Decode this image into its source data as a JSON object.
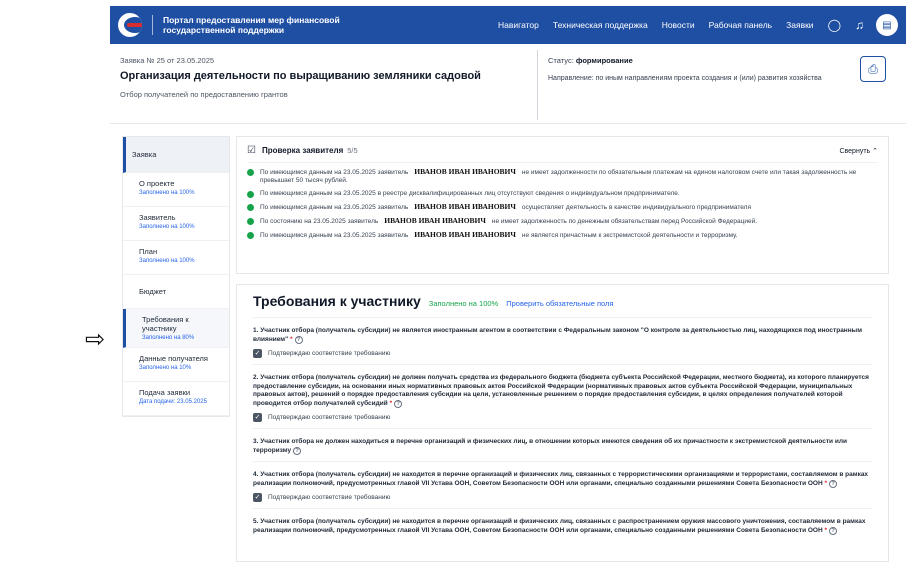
{
  "header": {
    "brand_line1": "Портал предоставления мер финансовой",
    "brand_line2": "государственной поддержки",
    "nav": [
      "Навигатор",
      "Техническая поддержка",
      "Новости",
      "Рабочая панель",
      "Заявки"
    ],
    "icons": [
      "chat-icon",
      "bell-icon",
      "avatar-icon"
    ]
  },
  "application": {
    "number": "Заявка № 25  от 23.05.2025",
    "title": "Организация деятельности по выращиванию земляники садовой",
    "subtitle": "Отбор получателей по предоставлению грантов",
    "status_label": "Статус:",
    "status_value": "формирование",
    "direction": "Направление: по иным направлениям проекта создания и (или) развития хозяйства"
  },
  "sidebar": {
    "head": "Заявка",
    "items": [
      {
        "label": "О проекте",
        "progress": "Заполнено на 100%"
      },
      {
        "label": "Заявитель",
        "progress": "Заполнено на 100%"
      },
      {
        "label": "План",
        "progress": "Заполнено на 100%"
      },
      {
        "label": "Бюджет",
        "progress": ""
      },
      {
        "label": "Требования к участнику",
        "progress": "Заполнено на 80%"
      },
      {
        "label": "Данные получателя",
        "progress": "Заполнено на 10%"
      },
      {
        "label": "Подача заявки",
        "progress": "Дата подачи: 23.05.2025"
      }
    ]
  },
  "checks": {
    "title": "Проверка заявителя",
    "count": "5/5",
    "collapse_label": "Свернуть",
    "rows": [
      {
        "pre": "По имеющимся данным на 23.05.2025 заявитель",
        "name": "ИВАНОВ ИВАН ИВАНОВИЧ",
        "post": "не имеет задолженности по обязательным платежам на едином налоговом счете или такая задолженность не превышает 50 тысяч рублей."
      },
      {
        "pre": "По имеющимся данным на 23.05.2025 в реестре дисквалифицированных лиц отсутствуют сведения о индивидуальном предпринимателе.",
        "name": "",
        "post": ""
      },
      {
        "pre": "По имеющимся данным на 23.05.2025 заявитель",
        "name": "ИВАНОВ ИВАН ИВАНОВИЧ",
        "post": "осуществляет деятельность в качестве индивидуального предпринимателя"
      },
      {
        "pre": "По состоянию на 23.05.2025 заявитель",
        "name": "ИВАНОВ ИВАН ИВАНОВИЧ",
        "post": "не имеет задолженность по денежным обязательствам перед Российской Федерацией."
      },
      {
        "pre": "По имеющимся данным на 23.05.2025 заявитель",
        "name": "ИВАНОВ ИВАН ИВАНОВИЧ",
        "post": "не является причастным к экстремистской деятельности и терроризму."
      }
    ]
  },
  "requirements": {
    "title": "Требования к участнику",
    "done": "Заполнено на 100%",
    "check_link": "Проверить обязательные поля",
    "confirm_label": "Подтверждаю соответствие требованию",
    "items": [
      {
        "text": "1. Участник отбора (получатель субсидии) не является иностранным агентом в соответствии с Федеральным законом \"О контроле за деятельностью лиц, находящихся под иностранным влиянием\"",
        "star": true,
        "confirm": true
      },
      {
        "text": "2. Участник отбора (получатель субсидии) не должен получать средства из федерального бюджета (бюджета субъекта Российской Федерации, местного бюджета), из которого планируется предоставление субсидии, на основании иных нормативных правовых актов Российской Федерации (нормативных правовых актов субъекта Российской Федерации, муниципальных правовых актов), решений о порядке предоставления субсидии на цели, установленные решением о порядке предоставления субсидии, в целях определения получателей которой проводится отбор получателей субсидий",
        "star": true,
        "confirm": true
      },
      {
        "text": "3. Участник отбора не должен находиться в перечне организаций и физических лиц, в отношении которых имеются сведения об их причастности к экстремистской деятельности или терроризму",
        "star": false,
        "confirm": false
      },
      {
        "text": "4. Участник отбора (получатель субсидии) не находится в перечне организаций и физических лиц, связанных с террористическими организациями и террористами, составляемом в рамках реализации полномочий, предусмотренных главой VII Устава ООН, Советом Безопасности ООН или органами, специально созданными решениями Совета Безопасности ООН",
        "star": true,
        "confirm": true
      },
      {
        "text": "5. Участник отбора (получатель субсидии) не находится в перечне организаций и физических лиц, связанных с распространением оружия массового уничтожения, составляемом в рамках реализации полномочий, предусмотренных главой VII Устава ООН, Советом Безопасности ООН или органами, специально созданными решениями Совета Безопасности ООН",
        "star": true,
        "confirm": false
      }
    ]
  }
}
